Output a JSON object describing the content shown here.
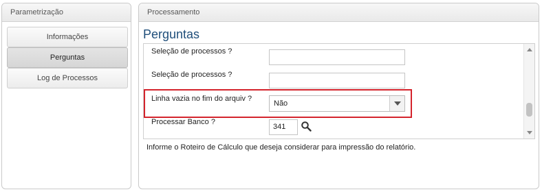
{
  "left_panel": {
    "title": "Parametrização",
    "nav": [
      {
        "label": "Informações",
        "active": false
      },
      {
        "label": "Perguntas",
        "active": true
      },
      {
        "label": "Log de Processos",
        "active": false
      }
    ]
  },
  "right_panel": {
    "title": "Processamento",
    "page_title": "Perguntas",
    "questions": [
      {
        "label": "Seleção de processos ?",
        "value": ""
      },
      {
        "label": "Seleção de processos ?",
        "value": ""
      },
      {
        "label": "Linha vazia no fim do arquiv ?",
        "value": "Não"
      },
      {
        "label": "Processar Banco ?",
        "value": "341"
      }
    ],
    "info": "Informe o Roteiro de Cálculo que deseja considerar para impressão do relatório."
  },
  "colors": {
    "highlight": "#d4232b",
    "title_blue": "#1f4e7a"
  },
  "icons": {
    "search": "magnifier-icon",
    "dropdown": "chevron-down-icon"
  }
}
